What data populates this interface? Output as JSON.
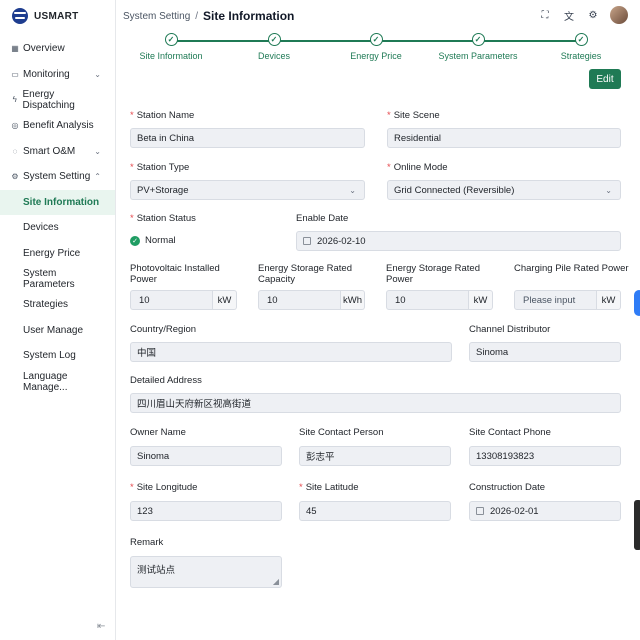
{
  "app": {
    "brand": "USMART"
  },
  "sidebar": {
    "items": [
      {
        "label": "Overview",
        "icon": "grid-icon"
      },
      {
        "label": "Monitoring",
        "icon": "monitor-icon",
        "has_children": true
      },
      {
        "label": "Energy Dispatching",
        "icon": "bolt-icon"
      },
      {
        "label": "Benefit Analysis",
        "icon": "analysis-icon"
      },
      {
        "label": "Smart O&M",
        "icon": "wrench-icon",
        "has_children": true
      },
      {
        "label": "System Setting",
        "icon": "gear-icon",
        "expanded": true
      }
    ],
    "sub_items": [
      {
        "label": "Site Information",
        "active": true
      },
      {
        "label": "Devices"
      },
      {
        "label": "Energy Price"
      },
      {
        "label": "System Parameters"
      },
      {
        "label": "Strategies"
      },
      {
        "label": "User Manage"
      },
      {
        "label": "System Log"
      },
      {
        "label": "Language Manage..."
      }
    ]
  },
  "header": {
    "breadcrumb_parent": "System Setting",
    "separator": "/",
    "title": "Site Information"
  },
  "steps": [
    {
      "label": "Site Information"
    },
    {
      "label": "Devices"
    },
    {
      "label": "Energy Price"
    },
    {
      "label": "System Parameters"
    },
    {
      "label": "Strategies"
    }
  ],
  "edit_label": "Edit",
  "form": {
    "station_name": {
      "label": "Station Name",
      "value": "Beta in China"
    },
    "site_scene": {
      "label": "Site Scene",
      "value": "Residential"
    },
    "station_type": {
      "label": "Station Type",
      "value": "PV+Storage"
    },
    "online_mode": {
      "label": "Online Mode",
      "value": "Grid Connected (Reversible)"
    },
    "station_status": {
      "label": "Station Status",
      "value": "Normal"
    },
    "enable_date": {
      "label": "Enable Date",
      "value": "2026-02-10"
    },
    "pv_power": {
      "label_1": "Photovoltaic Installed",
      "label_2": "Power",
      "value": "10",
      "unit": "kW"
    },
    "storage_capacity": {
      "label_1": "Energy Storage Rated",
      "label_2": "Capacity",
      "value": "10",
      "unit": "kWh"
    },
    "storage_power": {
      "label_1": "Energy Storage Rated",
      "label_2": "Power",
      "value": "10",
      "unit": "kW"
    },
    "charging_pile": {
      "label": "Charging Pile Rated Power",
      "placeholder": "Please input",
      "unit": "kW"
    },
    "country": {
      "label": "Country/Region",
      "value": "中国"
    },
    "channel": {
      "label": "Channel Distributor",
      "value": "Sinoma"
    },
    "address": {
      "label": "Detailed Address",
      "value": "四川眉山天府新区视高街道"
    },
    "owner": {
      "label": "Owner Name",
      "value": "Sinoma"
    },
    "contact_person": {
      "label": "Site Contact Person",
      "value": "彭志平"
    },
    "contact_phone": {
      "label": "Site Contact Phone",
      "value": "13308193823"
    },
    "longitude": {
      "label": "Site Longitude",
      "value": "123"
    },
    "latitude": {
      "label": "Site Latitude",
      "value": "45"
    },
    "construction_date": {
      "label": "Construction Date",
      "value": "2026-02-01"
    },
    "remark": {
      "label": "Remark",
      "value": "测试站点"
    }
  },
  "colors": {
    "accent": "#1f7a55",
    "required": "#e5484d",
    "input_bg": "#eef0f4"
  }
}
